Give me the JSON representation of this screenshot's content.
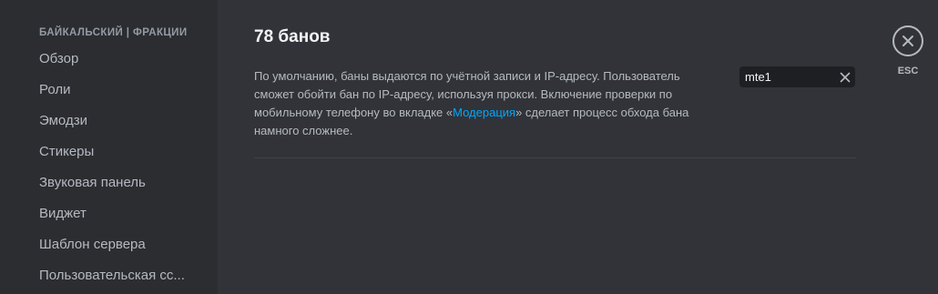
{
  "sidebar": {
    "header": "БАЙКАЛЬСКИЙ | ФРАКЦИИ",
    "items": [
      {
        "label": "Обзор"
      },
      {
        "label": "Роли"
      },
      {
        "label": "Эмодзи"
      },
      {
        "label": "Стикеры"
      },
      {
        "label": "Звуковая панель"
      },
      {
        "label": "Виджет"
      },
      {
        "label": "Шаблон сервера"
      },
      {
        "label": "Пользовательская сс..."
      }
    ]
  },
  "main": {
    "title": "78 банов",
    "description": {
      "before_link": "По умолчанию, баны выдаются по учётной записи и IP-адресу. Пользователь сможет обойти бан по IP-адресу, используя прокси. Включение проверки по мобильному телефону во вкладке «",
      "link": "Модерация",
      "after_link": "» сделает процесс обхода бана намного сложнее."
    },
    "search": {
      "value": "mte1"
    }
  },
  "close": {
    "esc_label": "ESC"
  },
  "colors": {
    "sidebar_bg": "#2b2d31",
    "main_bg": "#313338",
    "input_bg": "#1e1f22",
    "link": "#00a8fc",
    "text_primary": "#f2f3f5",
    "text_muted": "#b5bac1"
  },
  "icons": {
    "clear": "close-icon",
    "close": "close-circle-icon"
  }
}
